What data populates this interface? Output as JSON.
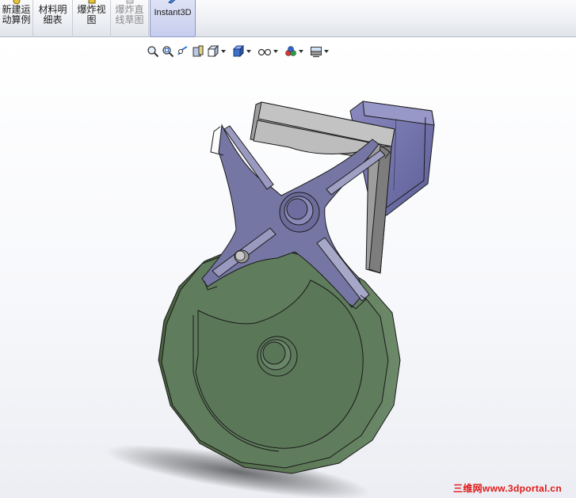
{
  "command_manager": {
    "buttons": [
      {
        "key": "new_motion_study",
        "label_line1": "新建运",
        "label_line2": "动算例",
        "enabled": true
      },
      {
        "key": "bill_of_materials",
        "label_line1": "材料明",
        "label_line2": "细表",
        "enabled": true
      },
      {
        "key": "exploded_view",
        "label_line1": "爆炸视",
        "label_line2": "图",
        "enabled": true
      },
      {
        "key": "explode_line_sketch",
        "label_line1": "爆炸直",
        "label_line2": "线草图",
        "enabled": false
      },
      {
        "key": "instant3d",
        "label_line1": "Instant3D",
        "label_line2": "",
        "enabled": true,
        "active": true
      }
    ]
  },
  "view_toolbar": {
    "icons": [
      "zoom-to-fit-icon",
      "zoom-to-area-icon",
      "previous-view-icon",
      "section-view-icon",
      "view-orientation-icon",
      "display-style-icon",
      "hide-show-items-icon",
      "edit-appearance-icon",
      "apply-scene-icon"
    ]
  },
  "model": {
    "colors": {
      "wheel": "#5f7c5c",
      "cross": "#7777a4",
      "guide_block": "#a8a8a8",
      "housing": "#7777b0",
      "edge": "#1a1a1a"
    }
  },
  "watermark": {
    "text": "三维网www.3dportal.cn",
    "color": "#e01818"
  }
}
